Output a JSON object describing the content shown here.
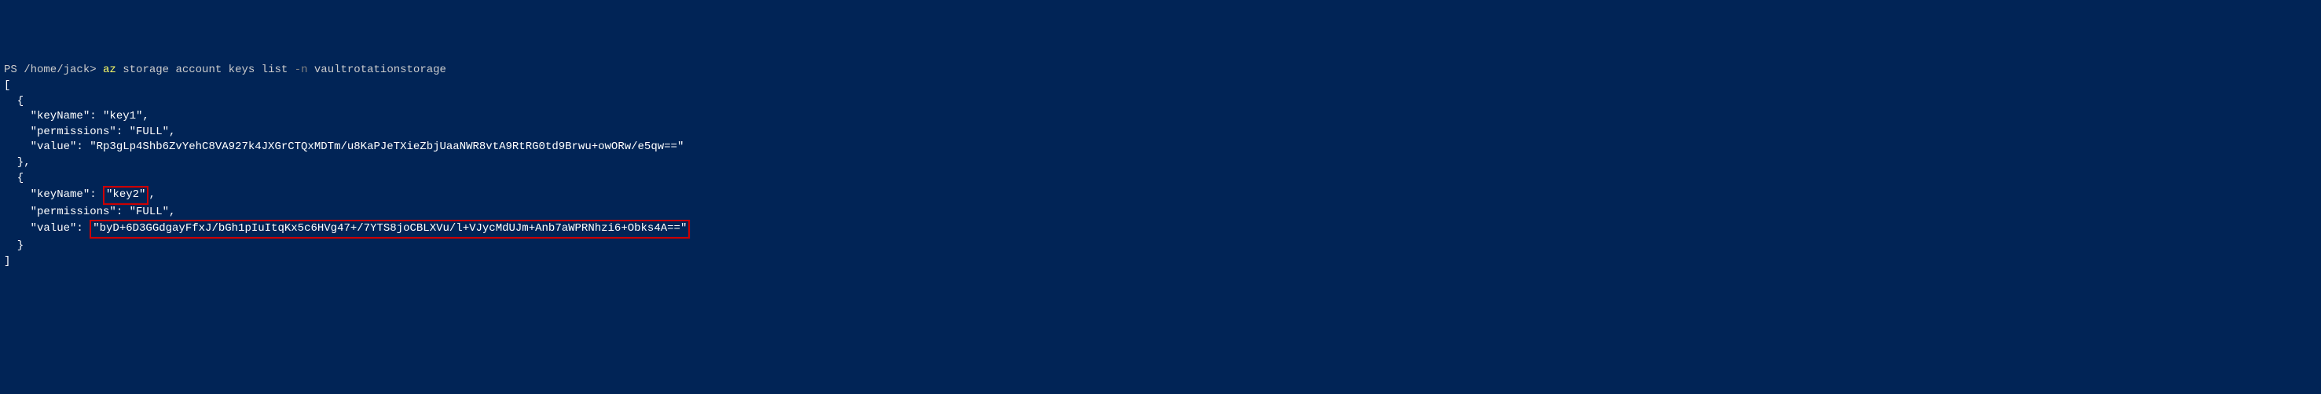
{
  "prompt": {
    "prefix": "PS /home/jack> ",
    "cmd_az": "az",
    "cmd_args1": " storage account keys list ",
    "cmd_flag": "-n",
    "cmd_args2": " vaultrotationstorage"
  },
  "output": {
    "line1": "[",
    "line2": "  {",
    "line3": "    \"keyName\": \"key1\",",
    "line4": "    \"permissions\": \"FULL\",",
    "line5": "    \"value\": \"Rp3gLp4Shb6ZvYehC8VA927k4JXGrCTQxMDTm/u8KaPJeTXieZbjUaaNWR8vtA9RtRG0td9Brwu+owORw/e5qw==\"",
    "line6": "  },",
    "line7": "  {",
    "line8a": "    \"keyName\": ",
    "line8b": "\"key2\"",
    "line8c": ",",
    "line9": "    \"permissions\": \"FULL\",",
    "line10a": "    \"value\": ",
    "line10b": "\"byD+6D3GGdgayFfxJ/bGh1pIuItqKx5c6HVg47+/7YTS8joCBLXVu/l+VJycMdUJm+Anb7aWPRNhzi6+Obks4A==\"",
    "line11": "  }",
    "line12": "]"
  }
}
